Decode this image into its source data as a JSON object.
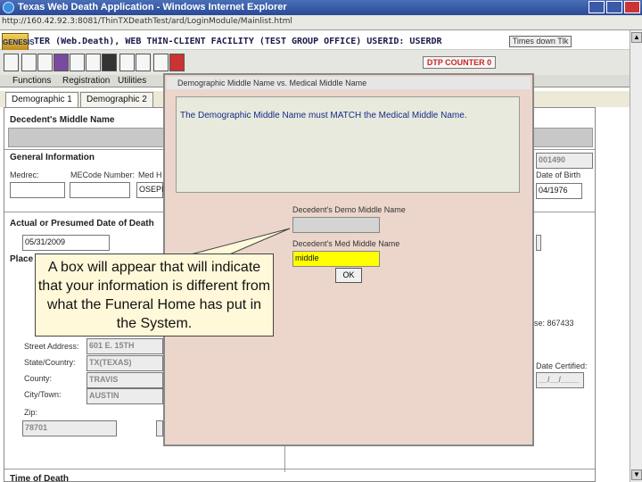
{
  "window": {
    "title": "Texas Web Death Application - Windows Internet Explorer",
    "url": "http://160.42.92.3:8081/ThinTXDeathTest/ard/LoginModule/Mainlist.html"
  },
  "app": {
    "logo_text": "GENESIS",
    "header": "TER (Web.Death), WEB THIN-CLIENT FACILITY (TEST GROUP OFFICE) USERID: USERDR",
    "times_button": "Times down Tlk",
    "dtp_counter": "DTP COUNTER 0"
  },
  "menu": [
    "Functions",
    "Registration",
    "Utilities"
  ],
  "tabs": [
    "Demographic 1",
    "Demographic 2"
  ],
  "form": {
    "middle_name_title": "Decedent's Middle Name",
    "general_info_title": "General Information",
    "medrec_label": "Medrec:",
    "mecode_label": "MECode Number:",
    "med_label": "Med H",
    "med_value": "OSEPI",
    "id_value": "001490",
    "dob_label": "Date of Birth",
    "dob_value": "04/1976",
    "date_of_death_title": "Actual or Presumed Date of Death",
    "date_of_death_value": "05/31/2009",
    "place_label": "Place",
    "street_label": "Street Address:",
    "street_value": "601 E. 15TH",
    "state_label": "State/Country:",
    "state_value": "TX(TEXAS)",
    "county_label": "County:",
    "county_value": "TRAVIS",
    "city_label": "City/Town:",
    "city_value": "AUSTIN",
    "zip_label": "Zip:",
    "zip_value": "78701",
    "license_partial": "se: 867433",
    "date_certified_label": "Date Certified:",
    "date_certified_value": "__/__/____",
    "time_of_death_title": "Time of Death"
  },
  "dialog": {
    "title": "Demographic Middle Name vs. Medical Middle Name",
    "message": "The Demographic Middle Name must MATCH the Medical Middle Name.",
    "demo_label": "Decedent's Demo Middle Name",
    "demo_value": "",
    "med_label": "Decedent's Med Middle Name",
    "med_value": "middle",
    "ok_label": "OK",
    "med_field_color": "#ffff00"
  },
  "callout": {
    "text": "A box will appear that will indicate that your information is different from what the Funeral Home has put in the System."
  }
}
